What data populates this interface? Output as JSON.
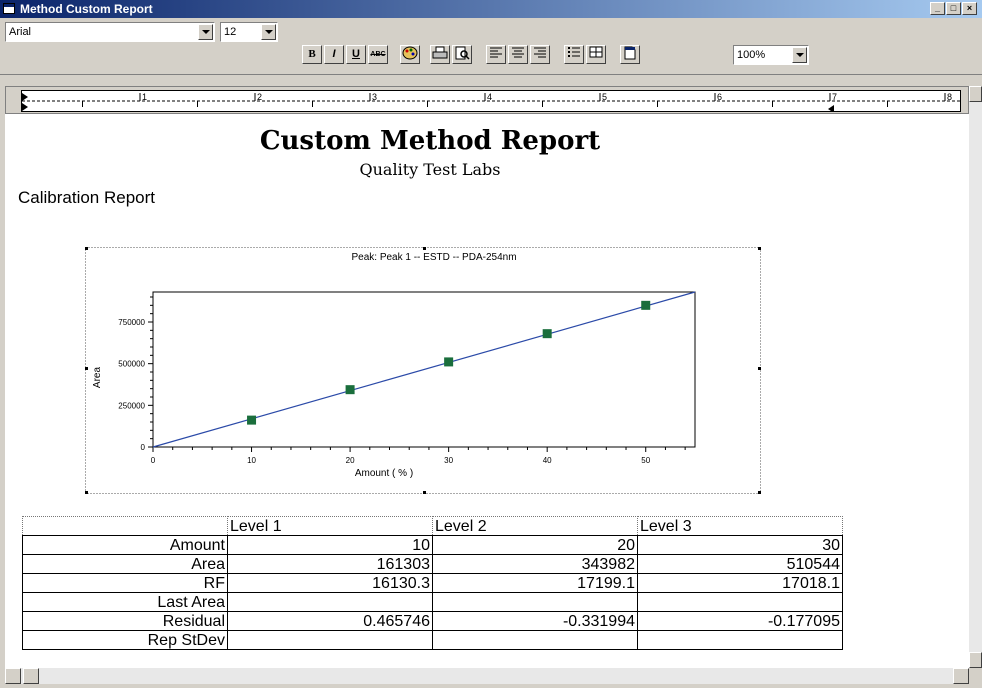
{
  "window": {
    "title": "Method Custom Report"
  },
  "toolbar": {
    "font": "Arial",
    "size": "12",
    "zoom": "100%",
    "bold": "B",
    "italic": "I",
    "underline": "U",
    "strike": "ABC"
  },
  "ruler": {
    "numbers": [
      "1",
      "2",
      "3",
      "4",
      "5",
      "6",
      "7",
      "8"
    ]
  },
  "report": {
    "title": "Custom Method Report",
    "subtitle": "Quality Test Labs",
    "section": "Calibration Report"
  },
  "chart_data": {
    "type": "scatter",
    "title": "Peak: Peak 1 -- ESTD -- PDA-254nm",
    "xlabel": "Amount ( % )",
    "ylabel": "Area",
    "xlim": [
      0,
      55
    ],
    "ylim": [
      0,
      930000
    ],
    "xticks": [
      0,
      10,
      20,
      30,
      40,
      50
    ],
    "yticks": [
      0,
      250000,
      500000,
      750000
    ],
    "points": [
      {
        "x": 10,
        "y": 161303
      },
      {
        "x": 20,
        "y": 343982
      },
      {
        "x": 30,
        "y": 510544
      },
      {
        "x": 40,
        "y": 680000
      },
      {
        "x": 50,
        "y": 850000
      }
    ],
    "fit_line": {
      "x": [
        0,
        55
      ],
      "y": [
        0,
        930000
      ]
    },
    "line_color": "#2b4aa8",
    "marker_color": "#1a6e3c",
    "legend": "none",
    "grid": false
  },
  "table": {
    "headers": [
      "",
      "Level 1",
      "Level 2",
      "Level 3"
    ],
    "rows": [
      [
        "Amount",
        "10",
        "20",
        "30"
      ],
      [
        "Area",
        "161303",
        "343982",
        "510544"
      ],
      [
        "RF",
        "16130.3",
        "17199.1",
        "17018.1"
      ],
      [
        "Last Area",
        "",
        "",
        ""
      ],
      [
        "Residual",
        "0.465746",
        "-0.331994",
        "-0.177095"
      ],
      [
        "Rep StDev",
        "",
        "",
        ""
      ]
    ]
  }
}
